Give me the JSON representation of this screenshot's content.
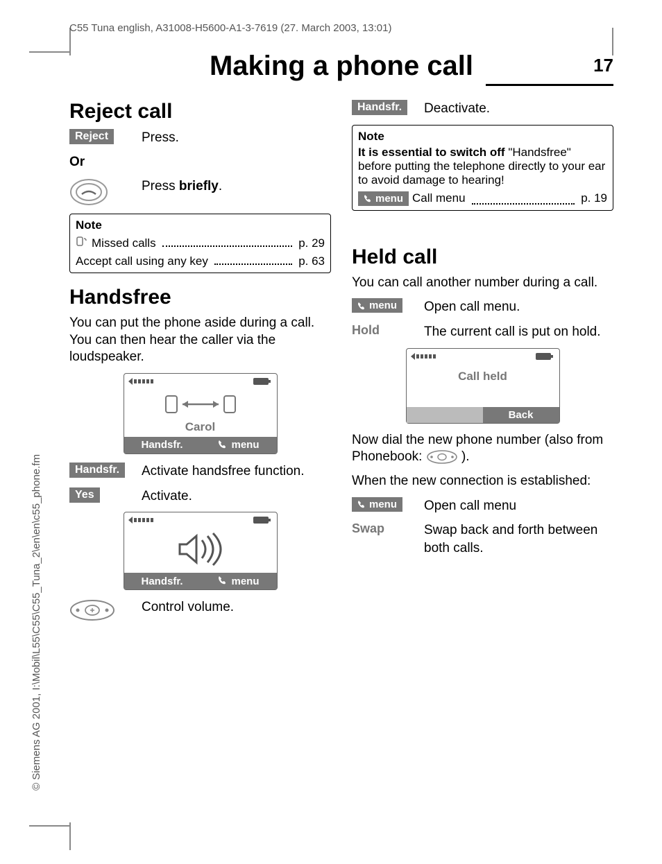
{
  "header": "C55 Tuna english, A31008-H5600-A1-3-7619 (27. March 2003, 13:01)",
  "title": "Making a phone call",
  "page_number": "17",
  "copyright": "© Siemens AG 2001, I:\\Mobil\\L55\\C55\\C55_Tuna_2\\en\\en\\c55_phone.fm",
  "reject": {
    "heading": "Reject call",
    "key": "Reject",
    "press": "Press.",
    "or": "Or",
    "press_briefly_a": "Press ",
    "press_briefly_b": "briefly",
    "press_briefly_c": ".",
    "note_title": "Note",
    "missed_calls": "Missed calls",
    "missed_page": "p. 29",
    "anykey": "Accept call using any key",
    "anykey_page": "p. 63"
  },
  "handsfree": {
    "heading": "Handsfree",
    "intro": "You can put the phone aside during a call. You can then hear the caller via the loudspeaker.",
    "screen1_name": "Carol",
    "screen_soft_left": "Handsfr.",
    "screen_soft_right": "menu",
    "key1": "Handsfr.",
    "key1_text": "Activate handsfree function.",
    "key2": "Yes",
    "key2_text": "Activate.",
    "volume_text": "Control volume.",
    "deact_key": "Handsfr.",
    "deact_text": "Deactivate.",
    "note_title": "Note",
    "note_body_strong": "It is essential to switch off ",
    "note_body_rest": "\"Handsfree\" before putting the telephone directly to your ear to avoid damage to hearing!",
    "call_menu": "Call menu",
    "call_menu_page": "p. 19"
  },
  "held": {
    "heading": "Held call",
    "intro": "You can call another number during a call.",
    "menu_key": "menu",
    "open_call_menu": "Open call menu.",
    "hold_key": "Hold",
    "hold_text": "The current call is put on hold.",
    "screen_title": "Call held",
    "screen_back": "Back",
    "dial_new": "Now dial the new phone number (also from Phonebook: ",
    "dial_new_end": ").",
    "established": "When the new connection is established:",
    "open_call_menu2": "Open call menu",
    "swap_key": "Swap",
    "swap_text": "Swap back and forth between both calls."
  }
}
